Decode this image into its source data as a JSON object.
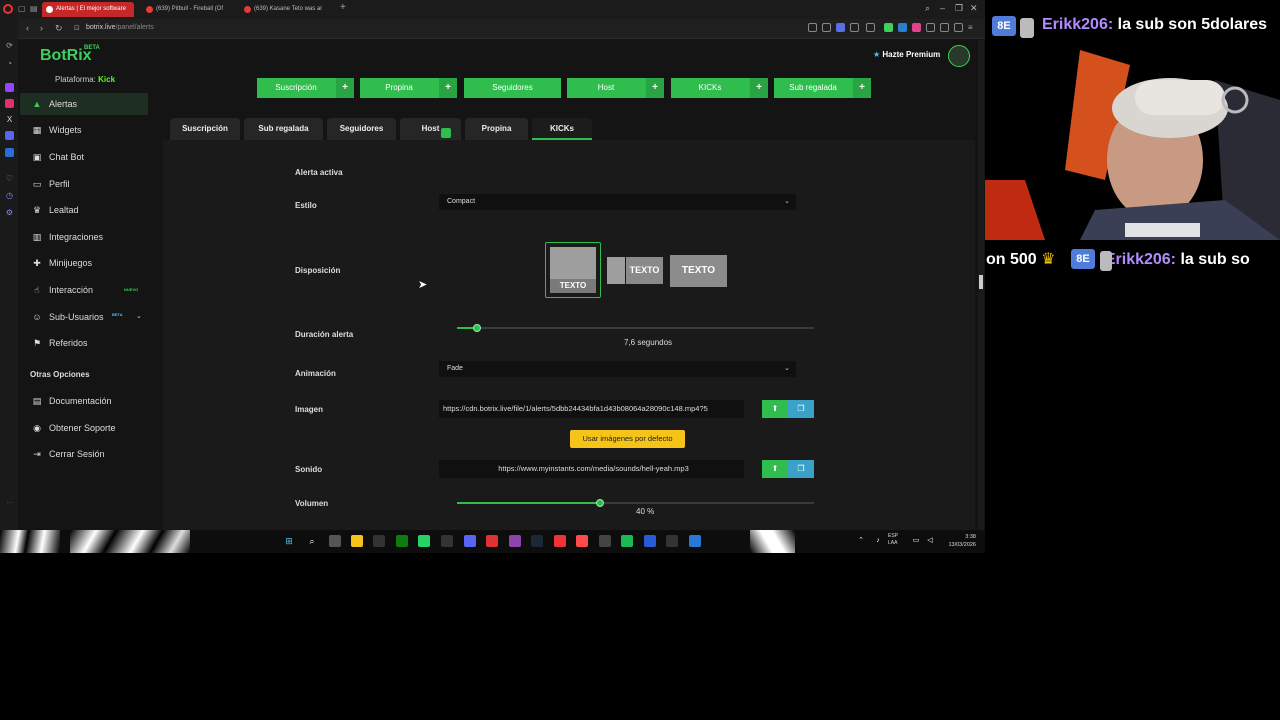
{
  "browser": {
    "tabs": [
      {
        "label": "Alertas | El mejor software",
        "active": true
      },
      {
        "label": "(639) Pitbull - Fireball (Of",
        "active": false
      },
      {
        "label": "(639) Kasane Teto was ar",
        "active": false
      }
    ],
    "new_tab": "+",
    "url_host": "botrix.live",
    "url_path": "/panel/alerts"
  },
  "app": {
    "brand": "BotRix",
    "brand_tag": "BETA",
    "platform_label": "Plataforma:",
    "platform_value": "Kick",
    "premium_label": "Hazte Premium",
    "sidebar": {
      "items": [
        {
          "label": "Alertas",
          "icon": "warning-icon"
        },
        {
          "label": "Widgets",
          "icon": "widgets-icon"
        },
        {
          "label": "Chat Bot",
          "icon": "chat-icon"
        },
        {
          "label": "Perfil",
          "icon": "id-card-icon"
        },
        {
          "label": "Lealtad",
          "icon": "trophy-icon"
        },
        {
          "label": "Integraciones",
          "icon": "integrations-icon"
        },
        {
          "label": "Minijuegos",
          "icon": "gamepad-icon"
        },
        {
          "label": "Interacción",
          "icon": "pointer-icon",
          "badge": "NUEVO"
        },
        {
          "label": "Sub-Usuarios",
          "icon": "users-icon",
          "badge": "BETA"
        },
        {
          "label": "Referidos",
          "icon": "referrals-icon"
        }
      ],
      "section_title": "Otras Opciones",
      "other_items": [
        {
          "label": "Documentación",
          "icon": "book-icon"
        },
        {
          "label": "Obtener Soporte",
          "icon": "support-icon"
        },
        {
          "label": "Cerrar Sesión",
          "icon": "logout-icon"
        }
      ]
    },
    "alert_buttons": [
      "Suscripción",
      "Propina",
      "Seguidores",
      "Host",
      "KICKs",
      "Sub regalada"
    ],
    "tabs": [
      "Suscripción",
      "Sub regalada",
      "Seguidores",
      "Host",
      "Propina",
      "KICKs"
    ],
    "active_tab": "KICKs",
    "form": {
      "alert_active_label": "Alerta activa",
      "alert_active": true,
      "style_label": "Estilo",
      "style_value": "Compact",
      "layout_label": "Disposición",
      "layout_text": "TEXTO",
      "duration_label": "Duración alerta",
      "duration_value": "7,6 segundos",
      "duration_fraction": 0.055,
      "animation_label": "Animación",
      "animation_value": "Fade",
      "image_label": "Imagen",
      "image_url": "https://cdn.botrix.live/file/1/alerts/5dbb24434bfa1d43b08064a28090c148.mp4?5",
      "default_images_button": "Usar imágenes por defecto",
      "sound_label": "Sonido",
      "sound_url": "https://www.myinstants.com/media/sounds/hell-yeah.mp3",
      "volume_label": "Volumen",
      "volume_value": "40 %",
      "volume_fraction": 0.4
    }
  },
  "taskbar": {
    "lang_1": "ESP",
    "lang_2": "LAA",
    "time": "3:38",
    "date": "13/03/2026"
  },
  "stream": {
    "chat_top_nick": "Erikk206:",
    "chat_top_msg": "la sub son 5dolares",
    "chat_bottom_prefix": "on 500",
    "chat_bottom_nick": "Erikk206:",
    "chat_bottom_msg": "la sub so"
  },
  "colors": {
    "accent": "#2fbd4e",
    "kick": "#53fc18",
    "default_btn": "#f6c419",
    "gallery_btn": "#3aa2c8",
    "chat_nick": "#b28cff"
  }
}
